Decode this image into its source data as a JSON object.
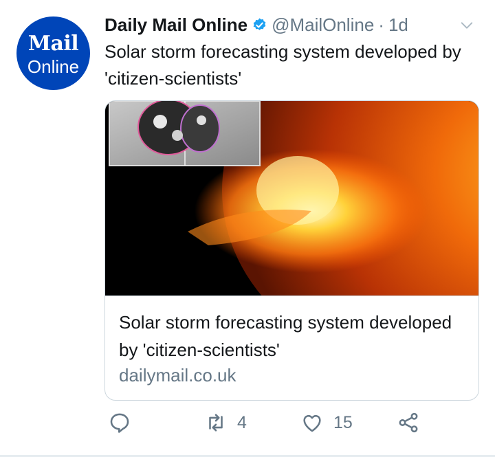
{
  "avatar": {
    "line1": "Mail",
    "line2": "Online"
  },
  "header": {
    "name": "Daily Mail Online",
    "handle": "@MailOnline",
    "separator": "·",
    "time": "1d"
  },
  "tweet": {
    "text": "Solar storm forecasting system developed by 'citizen-scientists'"
  },
  "card": {
    "title": "Solar storm forecasting system developed by 'citizen-scientists'",
    "domain": "dailymail.co.uk"
  },
  "actions": {
    "reply_count": "",
    "retweet_count": "4",
    "like_count": "15"
  },
  "colors": {
    "brand": "#0045b8",
    "verified": "#1da1f2",
    "muted": "#657786",
    "border": "#ccd6dd"
  },
  "icons": [
    "verified-badge-icon",
    "chevron-down-icon",
    "reply-icon",
    "retweet-icon",
    "heart-icon",
    "share-icon"
  ]
}
